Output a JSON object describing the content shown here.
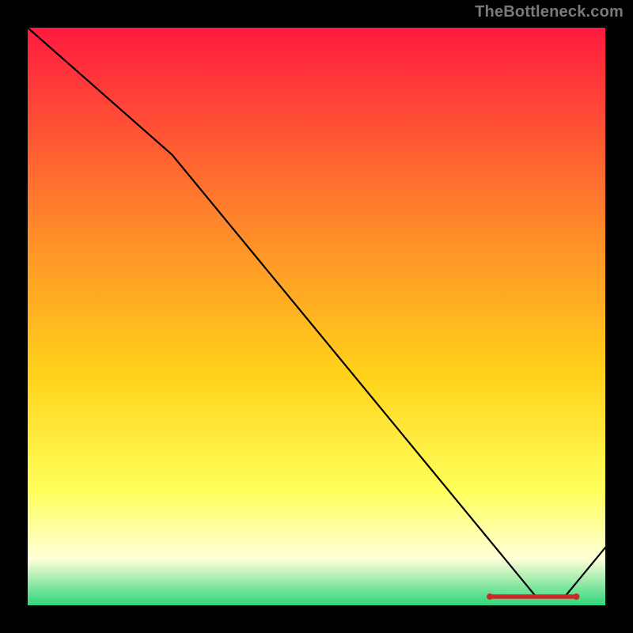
{
  "attribution": "TheBottleneck.com",
  "colors": {
    "gradient_top": "#ff1a3f",
    "gradient_upper_mid": "#ff8a2a",
    "gradient_mid": "#ffd21a",
    "gradient_lower_mid": "#ffff5a",
    "gradient_pale": "#ffffd9",
    "gradient_green": "#2fd67a",
    "curve_stroke": "#000000",
    "marker_stroke": "#cc2a2a"
  },
  "chart_data": {
    "type": "line",
    "title": "",
    "xlabel": "",
    "ylabel": "",
    "x": [
      0,
      25,
      88,
      93,
      100
    ],
    "values": [
      100,
      78,
      1.5,
      1.5,
      10
    ],
    "xlim": [
      0,
      100
    ],
    "ylim": [
      0,
      100
    ],
    "marker_range_x": [
      80,
      95
    ],
    "marker_y": 1.5
  }
}
